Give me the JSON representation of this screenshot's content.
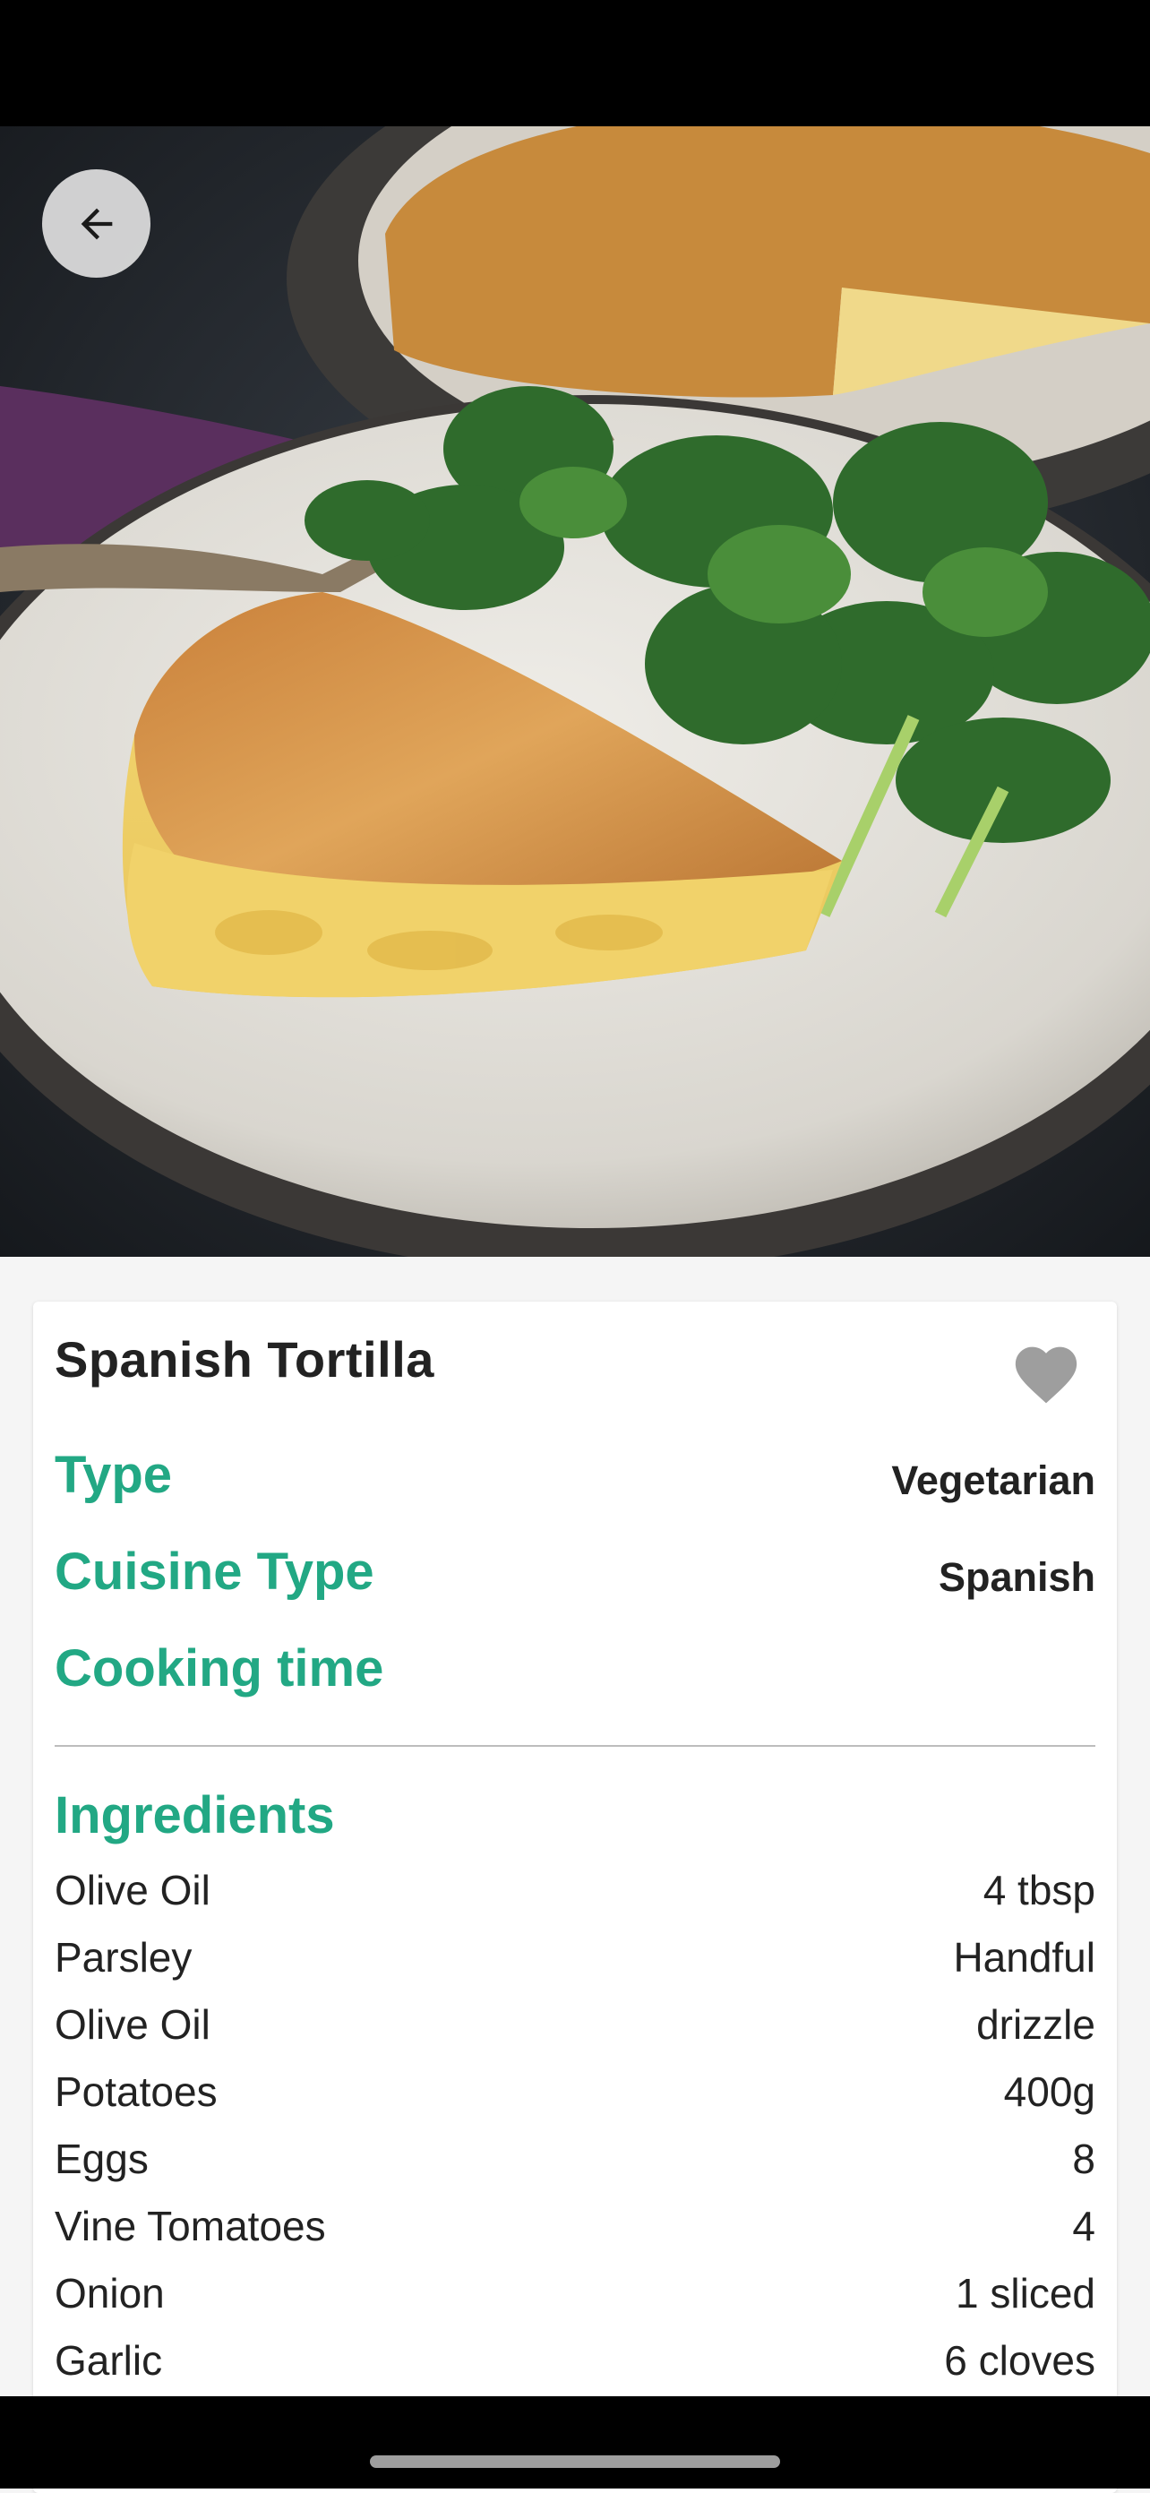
{
  "recipe": {
    "title": "Spanish Tortilla",
    "details": [
      {
        "label": "Type",
        "value": "Vegetarian"
      },
      {
        "label": "Cuisine Type",
        "value": "Spanish"
      },
      {
        "label": "Cooking time",
        "value": ""
      }
    ],
    "ingredients_title": "Ingredients",
    "ingredients": [
      {
        "name": "Olive Oil",
        "qty": "4 tbsp"
      },
      {
        "name": "Parsley",
        "qty": "Handful"
      },
      {
        "name": "Olive Oil",
        "qty": "drizzle"
      },
      {
        "name": "Potatoes",
        "qty": "400g"
      },
      {
        "name": "Eggs",
        "qty": "8"
      },
      {
        "name": "Vine Tomatoes",
        "qty": "4"
      },
      {
        "name": "Onion",
        "qty": "1 sliced"
      },
      {
        "name": "Garlic",
        "qty": "6 cloves"
      }
    ]
  },
  "icons": {
    "back": "arrow-left-icon",
    "favorite": "heart-icon"
  },
  "colors": {
    "accent": "#22a884",
    "text": "#222222",
    "favorite_icon": "#9e9e9e",
    "status_bar": "#000000"
  }
}
